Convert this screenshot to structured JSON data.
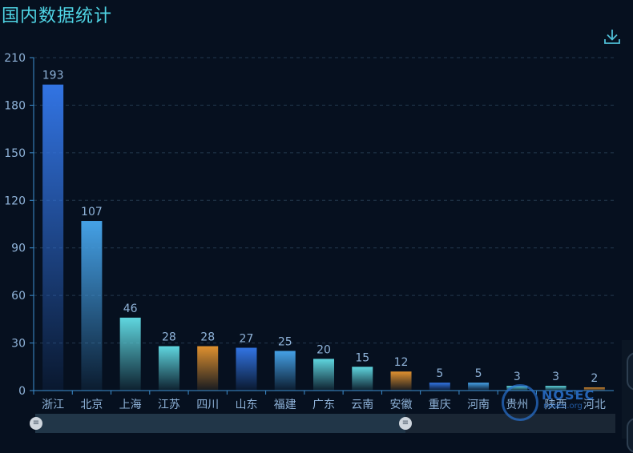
{
  "title": "国内数据统计",
  "download_icon": "download-icon",
  "colors": {
    "background": "#06101f",
    "title": "#4fd4e4",
    "axis": "#3d8fd0",
    "label": "#8fb3d9",
    "grid": "#23384f"
  },
  "chart_data": {
    "type": "bar",
    "title": "国内数据统计",
    "categories": [
      "浙江",
      "北京",
      "上海",
      "江苏",
      "四川",
      "山东",
      "福建",
      "广东",
      "云南",
      "安徽",
      "重庆",
      "河南",
      "贵州",
      "陕西",
      "河北"
    ],
    "values": [
      193,
      107,
      46,
      28,
      28,
      27,
      25,
      20,
      15,
      12,
      5,
      5,
      3,
      3,
      2
    ],
    "colors": [
      "#3274e3",
      "#45a1e6",
      "#5fd6df",
      "#5fd6df",
      "#e0912f",
      "#3274e3",
      "#45a1e6",
      "#5fd6df",
      "#5fd6df",
      "#e0912f",
      "#3274e3",
      "#45a1e6",
      "#5fd6df",
      "#5fd6df",
      "#e0912f"
    ],
    "ylim": [
      0,
      210
    ],
    "yticks": [
      0,
      30,
      60,
      90,
      120,
      150,
      180,
      210
    ],
    "grid": true,
    "data_labels": true
  },
  "watermark": {
    "brand": "NOSEC",
    "sub": "nosec.org"
  },
  "zoom": {
    "start": 0,
    "end": 64
  }
}
